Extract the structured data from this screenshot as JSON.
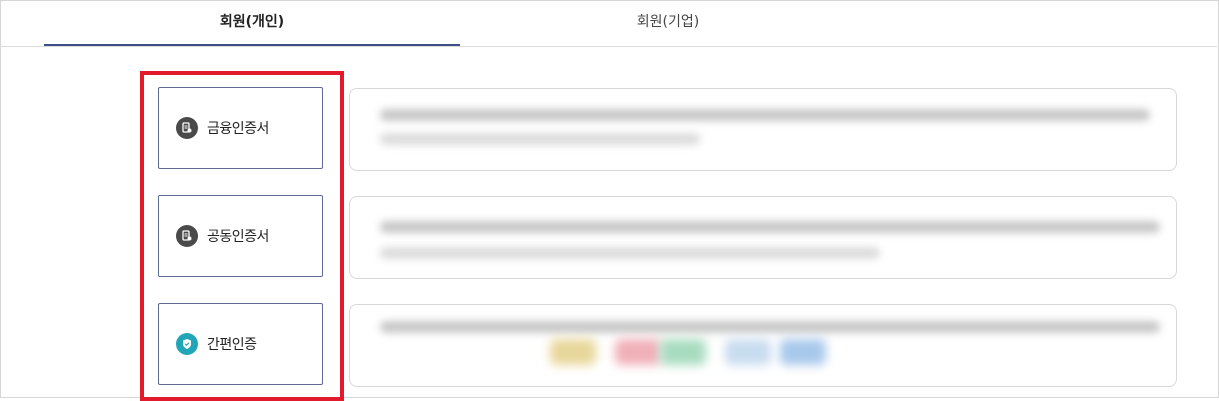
{
  "tabs": [
    {
      "label": "회원(개인)",
      "active": true
    },
    {
      "label": "회원(기업)",
      "active": false
    }
  ],
  "methods": [
    {
      "label": "금융인증서",
      "icon": "certificate-icon"
    },
    {
      "label": "공동인증서",
      "icon": "certificate-icon"
    },
    {
      "label": "간편인증",
      "icon": "shield-check-icon"
    }
  ],
  "colors": {
    "highlight": "#e21b2c",
    "tab_underline": "#3e4e87",
    "icon_dark": "#4a4a4a",
    "icon_teal": "#22a6b7"
  }
}
